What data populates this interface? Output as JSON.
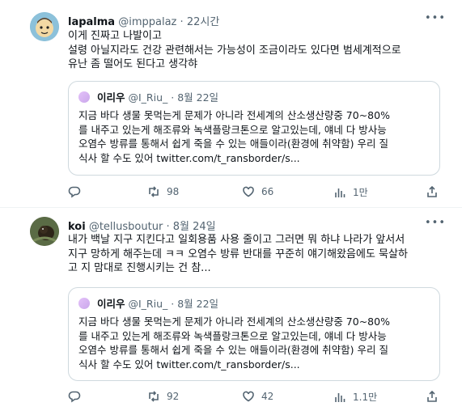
{
  "tweets": [
    {
      "name": "lapalma",
      "handle": "@imppalaz",
      "separator": "·",
      "time": "22시간",
      "text_lines": [
        "이게 진짜고 나발이고",
        "설령 아닐지라도 건강 관련해서는 가능성이 조금이라도 있다면 범세계적으로",
        "유난 좀 떨어도 된다고 생각햐"
      ],
      "quote": {
        "name": "이리우",
        "handle": "@I_Riu_",
        "separator": "·",
        "date": "8월 22일",
        "text_lines": [
          "지금 바다 생물 못먹는게 문제가 아니라 전세계의 산소생산량중 70~80%",
          "를 내주고 있는게 해조류와 녹색플랑크톤으로 알고있는데, 얘네 다 방사능",
          "오염수 방류를 통해서 쉽게 죽을 수 있는 애들이라(환경에 취약함) 우리 질",
          "식사 할 수도 있어 twitter.com/t_ransborder/s..."
        ]
      },
      "actions": {
        "reply": "",
        "retweets": "98",
        "likes": "66",
        "views": "1만"
      }
    },
    {
      "name": "koi",
      "handle": "@tellusboutur",
      "separator": "·",
      "time": "8월 24일",
      "text_lines": [
        "내가 백날 지구 지킨다고 일회용품 사용 줄이고 그러면 뭐 하냐 나라가 앞서서",
        "지구 망하게 해주는데 ㅋㅋ 오염수 방류 반대를 꾸준히 얘기해왔음에도 묵살하",
        "고 지 맘대로 진행시키는 건 참..."
      ],
      "quote": {
        "name": "이리우",
        "handle": "@I_Riu_",
        "separator": "·",
        "date": "8월 22일",
        "text_lines": [
          "지금 바다 생물 못먹는게 문제가 아니라 전세계의 산소생산량중 70~80%",
          "를 내주고 있는게 해조류와 녹색플랑크톤으로 알고있는데, 얘네 다 방사능",
          "오염수 방류를 통해서 쉽게 죽을 수 있는 애들이라(환경에 취약함) 우리 질",
          "식사 할 수도 있어 twitter.com/t_ransborder/s..."
        ]
      },
      "actions": {
        "reply": "",
        "retweets": "92",
        "likes": "42",
        "views": "1.1만"
      }
    }
  ],
  "icons": {
    "more": "more-horizontal-icon",
    "reply": "reply-icon",
    "retweet": "retweet-icon",
    "like": "heart-icon",
    "views": "views-bar-chart-icon",
    "share": "share-icon"
  },
  "colors": {
    "text": "#0f1419",
    "muted": "#536471",
    "border": "#cfd9de"
  }
}
